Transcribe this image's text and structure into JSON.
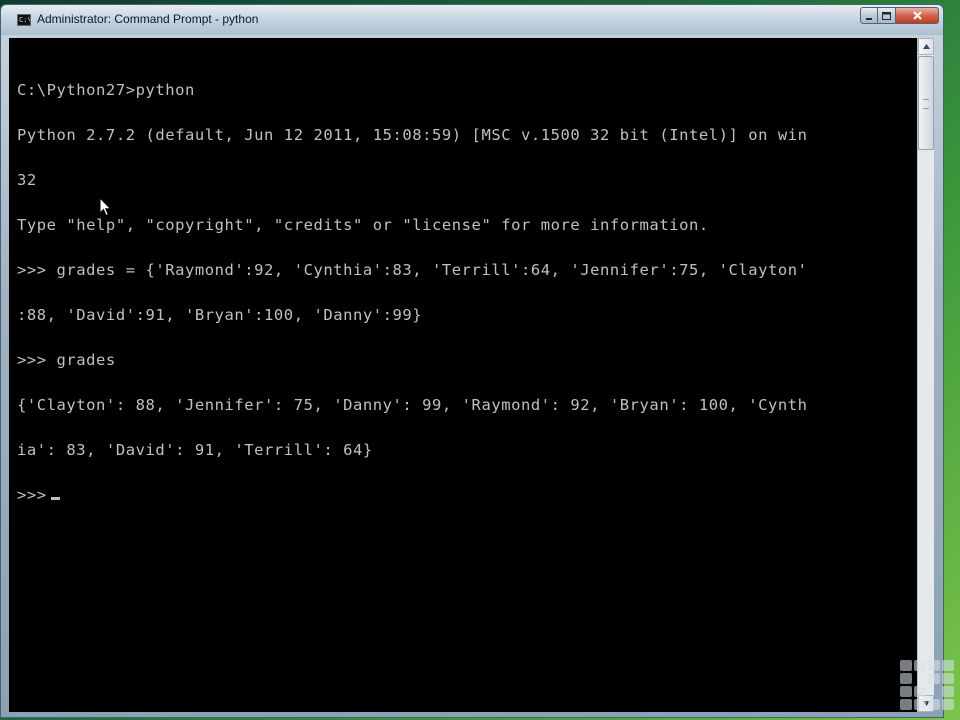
{
  "window": {
    "title": "Administrator: Command Prompt - python",
    "icon": "cmd-icon",
    "icon_text": "C:\\",
    "buttons": {
      "minimize": "minimize-icon",
      "maximize": "maximize-icon",
      "close": "close-icon"
    }
  },
  "console": {
    "lines": [
      "C:\\Python27>python",
      "Python 2.7.2 (default, Jun 12 2011, 15:08:59) [MSC v.1500 32 bit (Intel)] on win",
      "32",
      "Type \"help\", \"copyright\", \"credits\" or \"license\" for more information.",
      ">>> grades = {'Raymond':92, 'Cynthia':83, 'Terrill':64, 'Jennifer':75, 'Clayton'",
      ":88, 'David':91, 'Bryan':100, 'Danny':99}",
      ">>> grades",
      "{'Clayton': 88, 'Jennifer': 75, 'Danny': 99, 'Raymond': 92, 'Bryan': 100, 'Cynth",
      "ia': 83, 'David': 91, 'Terrill': 64}",
      ">>>"
    ],
    "text_color": "#c0c0c0",
    "background_color": "#000000"
  },
  "colors": {
    "close_button": "#c23e23",
    "titlebar": "#c9d6e0"
  }
}
